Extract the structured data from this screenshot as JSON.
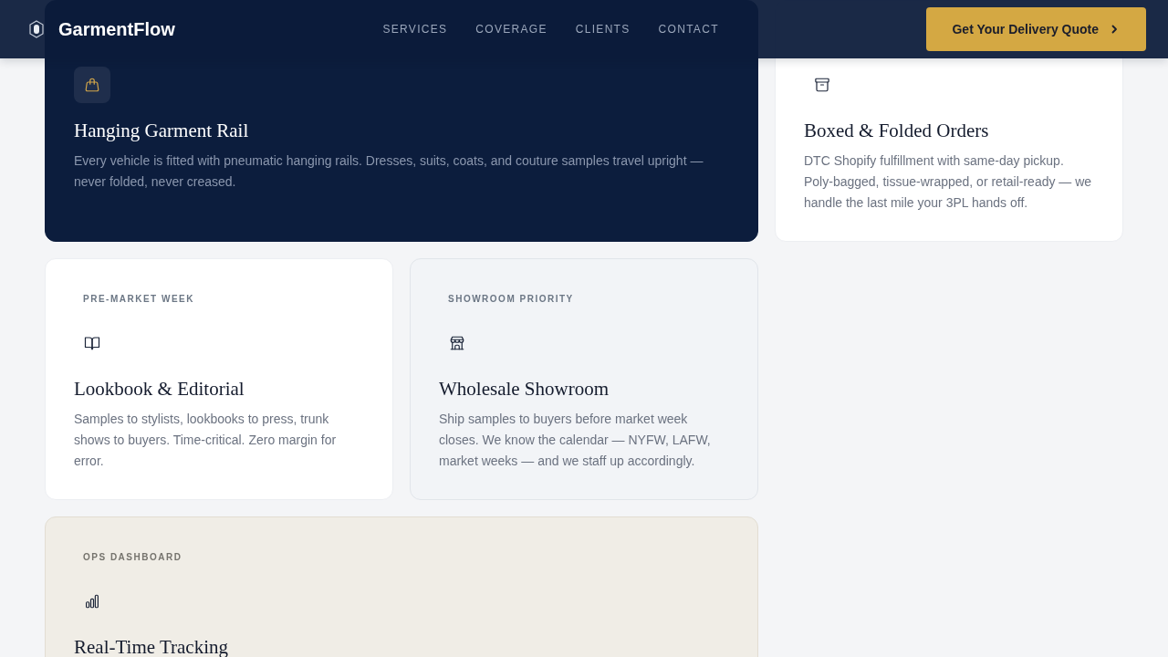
{
  "header": {
    "brand": "GarmentFlow",
    "nav": [
      "SERVICES",
      "COVERAGE",
      "CLIENTS",
      "CONTACT"
    ],
    "cta": "Get Your Delivery Quote"
  },
  "cards": [
    {
      "kind": "featured",
      "title": "Hanging Garment Rail",
      "description": "Every vehicle is fitted with pneumatic hanging rails. Dresses, suits, coats, and couture samples travel upright — never folded, never creased."
    },
    {
      "kind": "plain",
      "title": "Boxed & Folded Orders",
      "description": "DTC Shopify fulfillment with same-day pickup. Poly-bagged, tissue-wrapped, or retail-ready — we handle the last mile your 3PL hands off."
    },
    {
      "kind": "plain",
      "label": "PRE-MARKET WEEK",
      "title": "Lookbook & Editorial",
      "description": "Samples to stylists, lookbooks to press, trunk shows to buyers. Time-critical. Zero margin for error."
    },
    {
      "kind": "muted",
      "label": "SHOWROOM PRIORITY",
      "title": "Wholesale Showroom",
      "description": "Ship samples to buyers before market week closes. We know the calendar — NYFW, LAFW, market weeks — and we staff up accordingly."
    },
    {
      "kind": "tinted",
      "label": "OPS DASHBOARD",
      "title": "Real-Time Tracking"
    }
  ]
}
